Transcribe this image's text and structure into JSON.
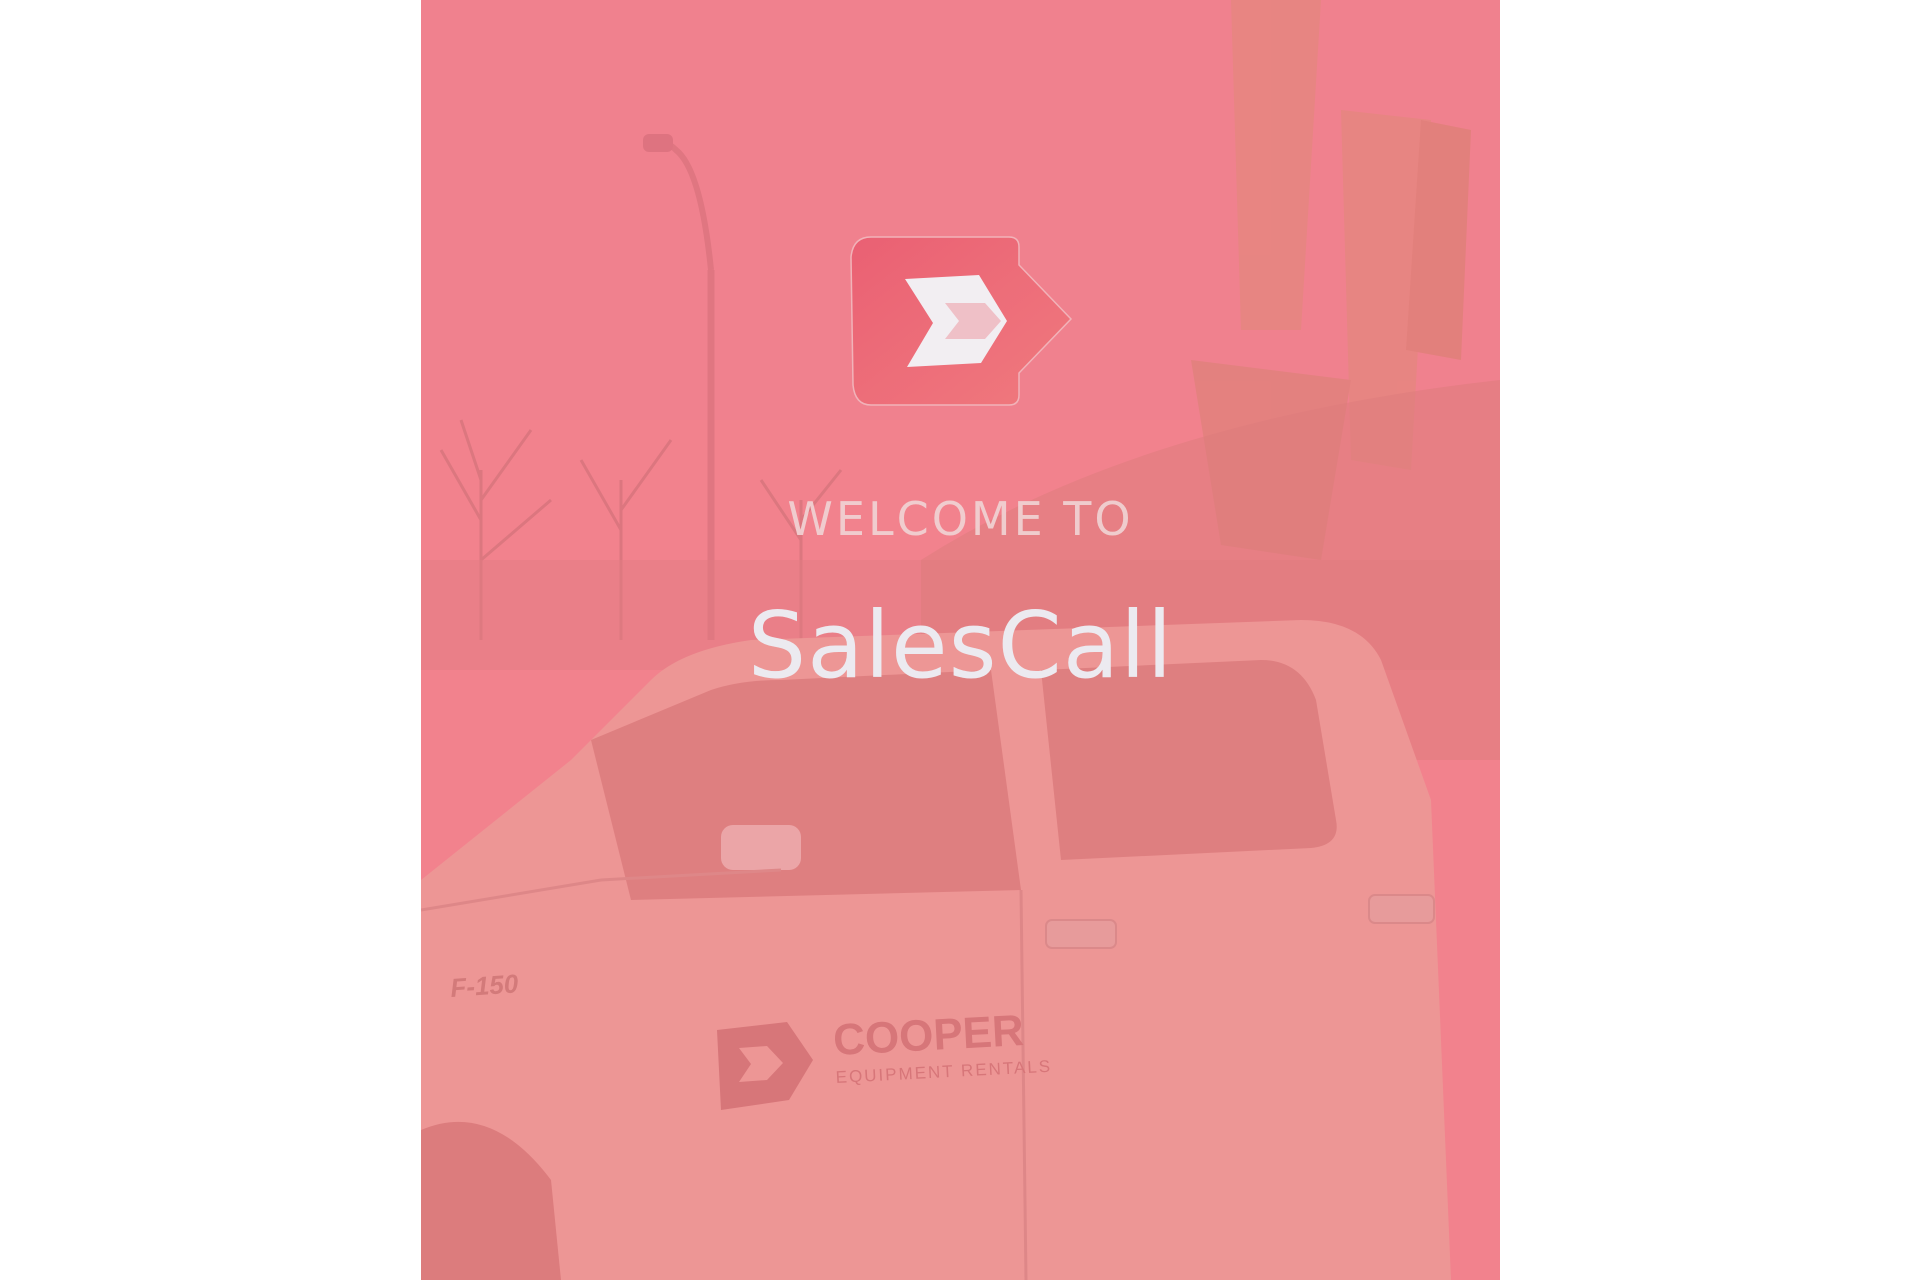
{
  "splash": {
    "welcome_text": "WELCOME TO",
    "app_name": "SalesCall",
    "overlay_color": "#f2828c",
    "logo_icon": "cooper-arrow-logo-icon"
  },
  "background_photo": {
    "truck_model_badge": "F-150",
    "door_brand": "COOPER",
    "door_brand_sub": "EQUIPMENT RENTALS"
  }
}
